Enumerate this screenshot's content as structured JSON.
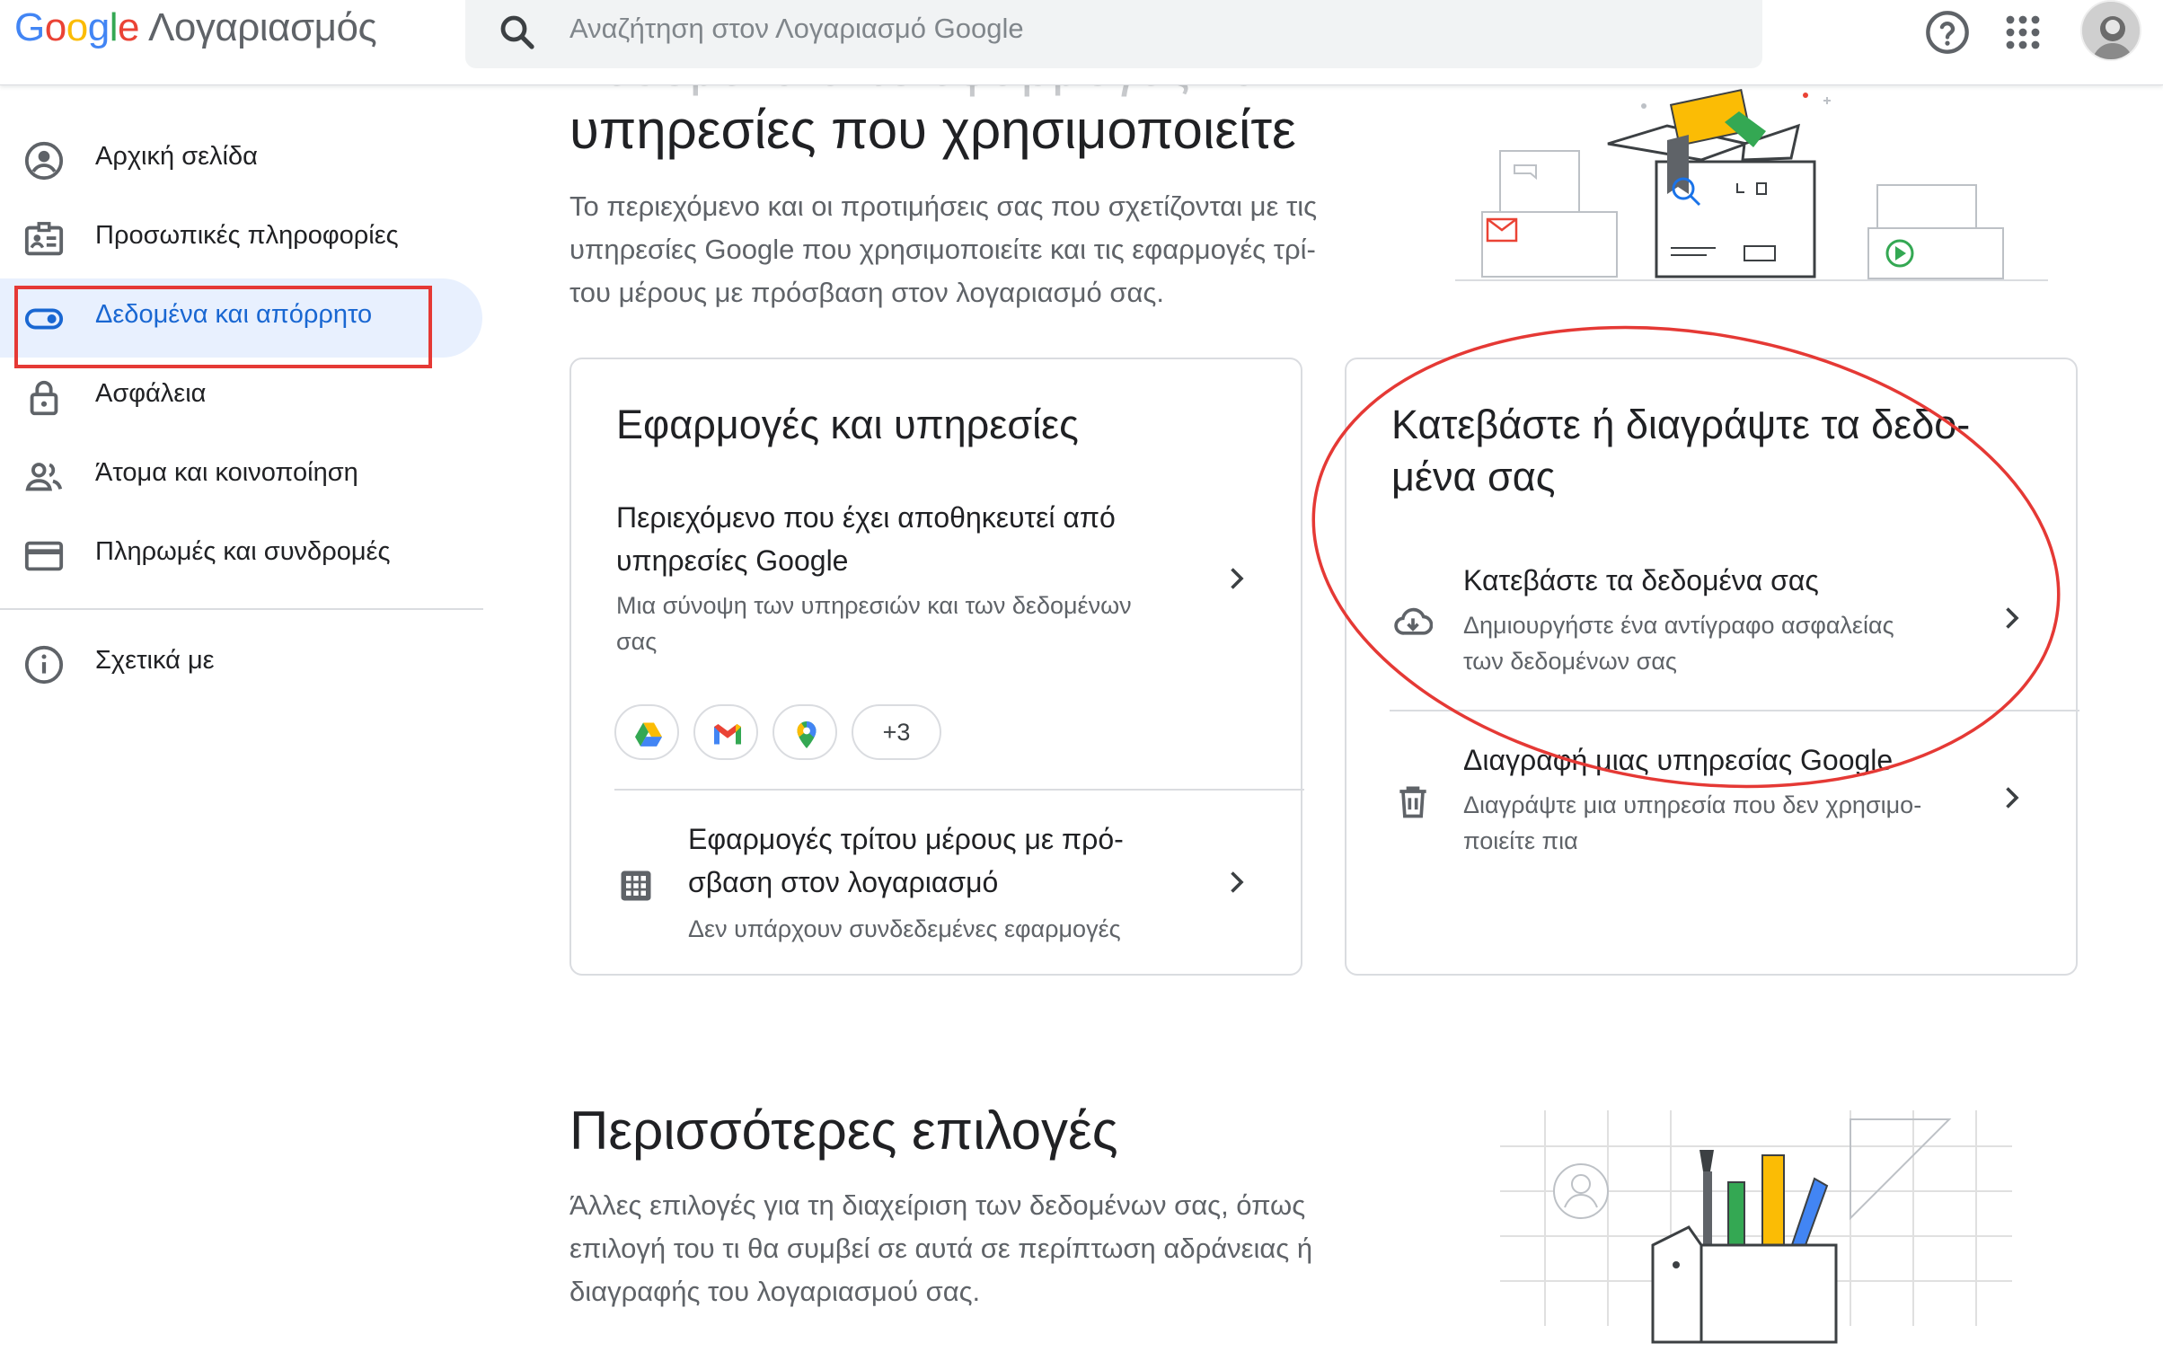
{
  "header": {
    "logo_letters": [
      "G",
      "o",
      "o",
      "g",
      "l",
      "e"
    ],
    "product": "Λογαριασμός",
    "search_placeholder": "Αναζήτηση στον Λογαριασμό Google"
  },
  "sidebar": {
    "items": [
      {
        "label": "Αρχική σελίδα",
        "icon": "account-circle-icon"
      },
      {
        "label": "Προσωπικές πληροφορίες",
        "icon": "id-card-icon"
      },
      {
        "label": "Δεδομένα και απόρρητο",
        "icon": "toggle-icon",
        "active": true
      },
      {
        "label": "Ασφάλεια",
        "icon": "lock-icon"
      },
      {
        "label": "Άτομα και κοινοποίηση",
        "icon": "people-icon"
      },
      {
        "label": "Πληρωμές και συνδρομές",
        "icon": "credit-card-icon"
      },
      {
        "label": "Σχετικά με",
        "icon": "info-icon"
      }
    ]
  },
  "main": {
    "section1": {
      "heading_cut": "Δεδομένα από εφαρμογές και",
      "heading": "υπηρεσίες που χρησιμοποιείτε",
      "desc_lines": [
        "Το περιεχόμενο και οι προτιμήσεις σας που σχετίζονται με τις",
        "υπηρεσίες Google που χρησιμοποιείτε και τις εφαρμογές τρί-",
        "του μέρους με πρόσβαση στον λογαριασμό σας."
      ]
    },
    "apps_card": {
      "title": "Εφαρμογές και υπηρεσίες",
      "row1": {
        "title_lines": [
          "Περιεχόμενο που έχει αποθηκευτεί από",
          "υπηρεσίες Google"
        ],
        "sub_lines": [
          "Μια σύνοψη των υπηρεσιών και των δεδομένων",
          "σας"
        ]
      },
      "chips_more": "+3",
      "row2": {
        "title_lines": [
          "Εφαρμογές τρίτου μέρους με πρό-",
          "σβαση στον λογαριασμό"
        ],
        "sub": "Δεν υπάρχουν συνδεδεμένες εφαρμογές"
      }
    },
    "download_card": {
      "title_lines": [
        "Κατεβάστε ή διαγράψτε τα δεδο-",
        "μένα σας"
      ],
      "row1": {
        "title": "Κατεβάστε τα δεδομένα σας",
        "sub_lines": [
          "Δημιουργήστε ένα αντίγραφο ασφαλείας",
          "των δεδομένων σας"
        ]
      },
      "row2": {
        "title": "Διαγραφή μιας υπηρεσίας Google",
        "sub_lines": [
          "Διαγράψτε μια υπηρεσία που δεν χρησιμο-",
          "ποιείτε πια"
        ]
      }
    },
    "section2": {
      "heading": "Περισσότερες επιλογές",
      "desc_lines": [
        "Άλλες επιλογές για τη διαχείριση των δεδομένων σας, όπως",
        "επιλογή του τι θα συμβεί σε αυτά σε περίπτωση αδράνειας ή",
        "διαγραφής του λογαριασμού σας."
      ]
    }
  },
  "colors": {
    "active_bg": "#e8f0fe",
    "active_text": "#1967d2",
    "annotation_red": "#e53935"
  }
}
